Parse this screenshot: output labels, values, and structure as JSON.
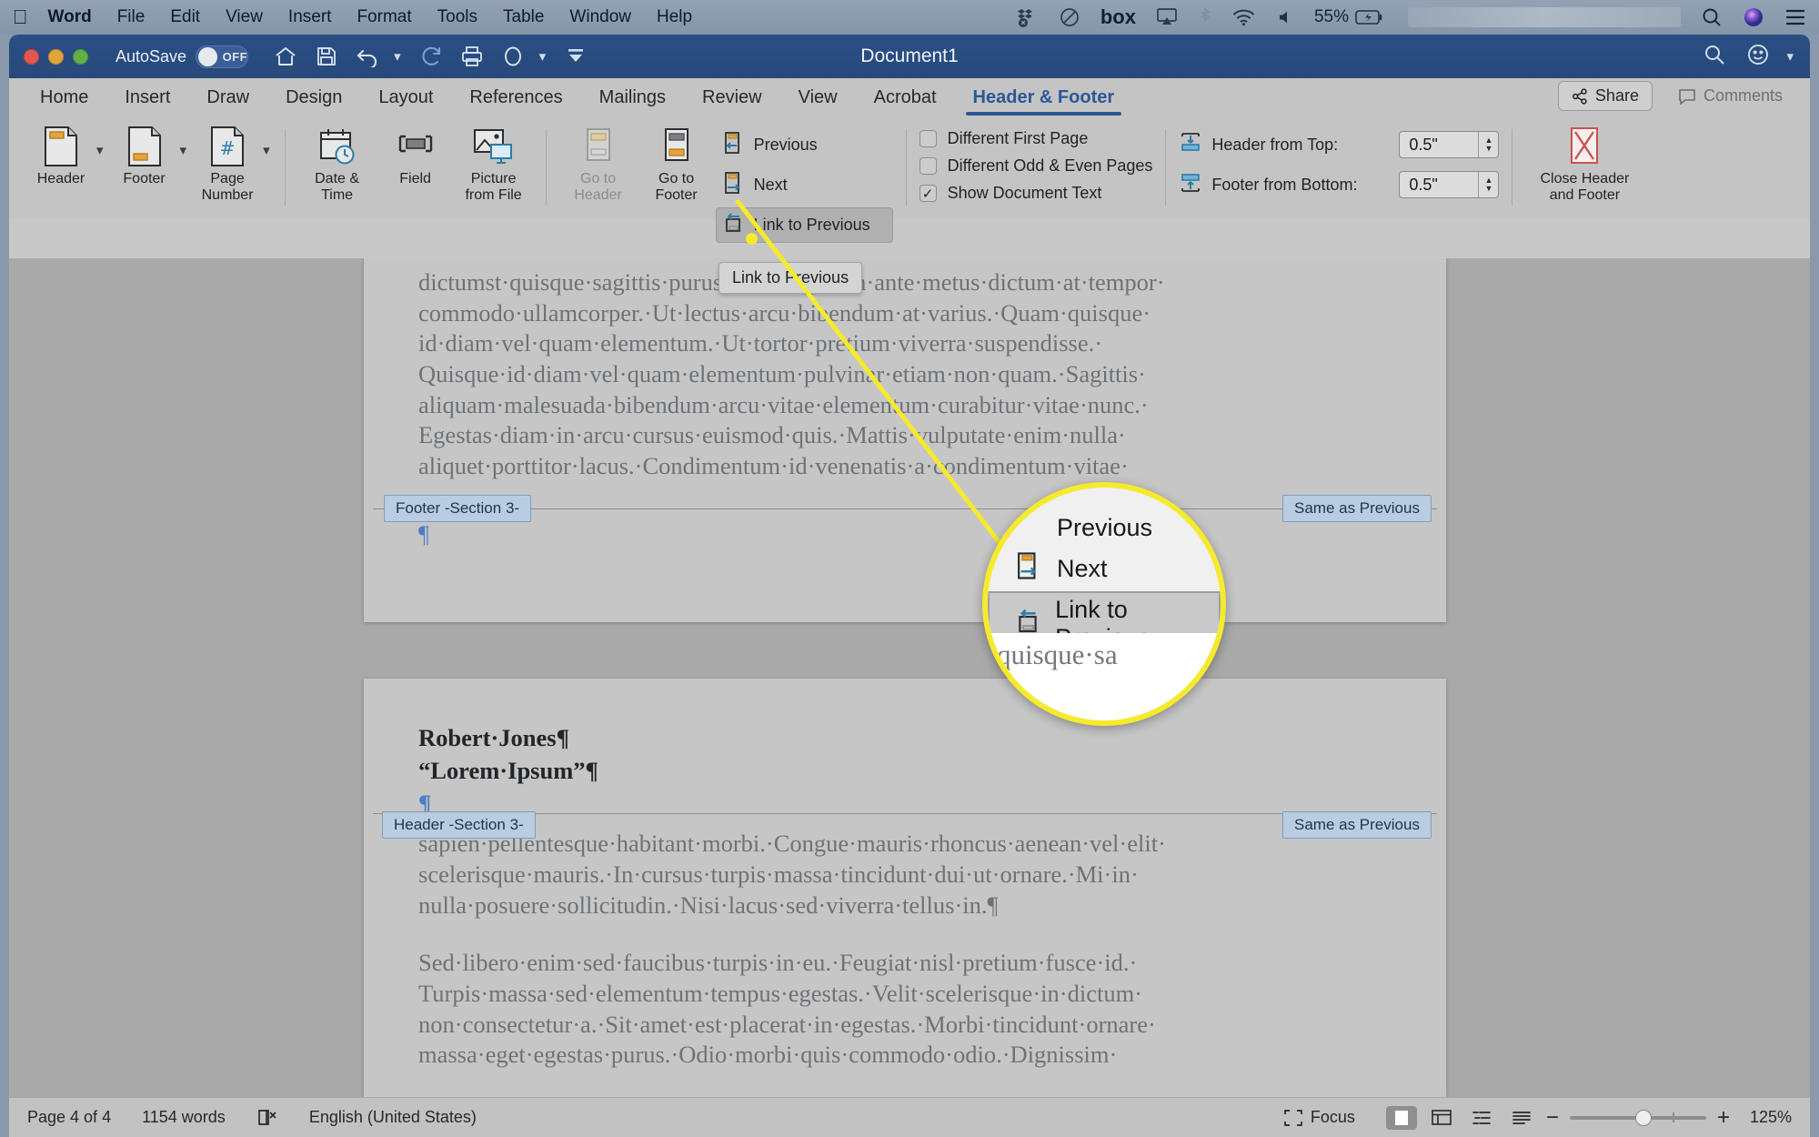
{
  "macbar": {
    "apple_icon": "apple-icon",
    "menus": [
      {
        "label": "Word",
        "bold": true
      },
      {
        "label": "File",
        "bold": false
      },
      {
        "label": "Edit",
        "bold": false
      },
      {
        "label": "View",
        "bold": false
      },
      {
        "label": "Insert",
        "bold": false
      },
      {
        "label": "Format",
        "bold": false
      },
      {
        "label": "Tools",
        "bold": false
      },
      {
        "label": "Table",
        "bold": false
      },
      {
        "label": "Window",
        "bold": false
      },
      {
        "label": "Help",
        "bold": false
      }
    ],
    "status_items": [
      {
        "name": "dropbox-paused-icon"
      },
      {
        "name": "adobe-creative-cloud-icon"
      },
      {
        "name": "box-icon",
        "label": "box"
      },
      {
        "name": "airplay-icon"
      },
      {
        "name": "bluetooth-icon"
      },
      {
        "name": "wifi-icon"
      },
      {
        "name": "volume-icon"
      }
    ],
    "battery_percent": "55%",
    "right_icons": [
      {
        "name": "spotlight-search-icon"
      },
      {
        "name": "siri-icon"
      },
      {
        "name": "control-center-icon"
      }
    ]
  },
  "titlebar": {
    "autosave_label": "AutoSave",
    "autosave_state": "OFF",
    "document_title": "Document1",
    "quick_access": [
      {
        "name": "home-icon"
      },
      {
        "name": "save-icon"
      },
      {
        "name": "undo-icon"
      },
      {
        "name": "undo-dropdown-caret"
      },
      {
        "name": "redo-icon"
      },
      {
        "name": "print-icon"
      },
      {
        "name": "format-painter-icon"
      },
      {
        "name": "format-painter-caret"
      },
      {
        "name": "customize-toolbar-icon"
      }
    ],
    "search_icon": "search-icon",
    "account_icon": "smiley-account-icon",
    "account_caret": "chevron-down-icon"
  },
  "ribbon": {
    "tabs": [
      {
        "label": "Home",
        "active": false
      },
      {
        "label": "Insert",
        "active": false
      },
      {
        "label": "Draw",
        "active": false
      },
      {
        "label": "Design",
        "active": false
      },
      {
        "label": "Layout",
        "active": false
      },
      {
        "label": "References",
        "active": false
      },
      {
        "label": "Mailings",
        "active": false
      },
      {
        "label": "Review",
        "active": false
      },
      {
        "label": "View",
        "active": false
      },
      {
        "label": "Acrobat",
        "active": false
      },
      {
        "label": "Header & Footer",
        "active": true
      }
    ],
    "share_label": "Share",
    "comments_label": "Comments",
    "buttons": [
      {
        "label": "Header",
        "icon": "header-icon",
        "caret": true,
        "dim": false
      },
      {
        "label": "Footer",
        "icon": "footer-icon",
        "caret": true,
        "dim": false
      },
      {
        "label": "Page\nNumber",
        "icon": "page-number-icon",
        "caret": true,
        "dim": false
      },
      {
        "label": "Date &\nTime",
        "icon": "date-time-icon",
        "caret": false,
        "dim": false
      },
      {
        "label": "Field",
        "icon": "field-icon",
        "caret": false,
        "dim": false
      },
      {
        "label": "Picture\nfrom File",
        "icon": "picture-from-file-icon",
        "caret": false,
        "dim": false
      },
      {
        "label": "Go to\nHeader",
        "icon": "go-to-header-icon",
        "caret": false,
        "dim": true
      },
      {
        "label": "Go to\nFooter",
        "icon": "go-to-footer-icon",
        "caret": false,
        "dim": false
      }
    ],
    "nav_items": [
      {
        "label": "Previous",
        "icon": "previous-section-icon",
        "selected": false
      },
      {
        "label": "Next",
        "icon": "next-section-icon",
        "selected": false
      },
      {
        "label": "Link to Previous",
        "icon": "link-to-previous-icon",
        "selected": true
      }
    ],
    "checkboxes": [
      {
        "label": "Different First Page",
        "checked": false
      },
      {
        "label": "Different Odd & Even Pages",
        "checked": false
      },
      {
        "label": "Show Document Text",
        "checked": true
      }
    ],
    "spinners": [
      {
        "label": "Header from Top:",
        "value": "0.5\"",
        "icon": "header-from-top-icon"
      },
      {
        "label": "Footer from Bottom:",
        "value": "0.5\"",
        "icon": "footer-from-bottom-icon"
      }
    ],
    "close_button": {
      "label": "Close Header\nand Footer",
      "icon": "close-header-footer-icon"
    }
  },
  "tooltip": {
    "text": "Link to Previous"
  },
  "magnifier": {
    "items": [
      {
        "label": "Previous",
        "icon": "previous-section-icon",
        "selected": false
      },
      {
        "label": "Next",
        "icon": "next-section-icon",
        "selected": false
      },
      {
        "label": "Link to Previous",
        "icon": "link-to-previous-icon",
        "selected": true
      }
    ],
    "tooltip_fragment": "L",
    "ghost_text": "quisque·sa",
    "border_color": "#f5ea2c"
  },
  "document": {
    "page_top": {
      "lines": [
        "dictumst·quisque·sagittis·purus·sit.·Feugiat·in·ante·metus·dictum·at·tempor·",
        "commodo·ullamcorper.·Ut·lectus·arcu·bibendum·at·varius.·Quam·quisque·",
        "id·diam·vel·quam·elementum.·Ut·tortor·pretium·viverra·suspendisse.·",
        "Quisque·id·diam·vel·quam·elementum·pulvinar·etiam·non·quam.·Sagittis·",
        "aliquam·malesuada·bibendum·arcu·vitae·elementum·curabitur·vitae·nunc.·",
        "Egestas·diam·in·arcu·cursus·euismod·quis.·Mattis·vulputate·enim·nulla·",
        "aliquet·porttitor·lacus.·Condimentum·id·venenatis·a·condimentum·vitae·"
      ]
    },
    "footer_tag_left": "Footer -Section 3-",
    "footer_tag_right": "Same as Previous",
    "footer_paragraph_mark": "¶",
    "header_block": {
      "author": "Robert·Jones¶",
      "title": "“Lorem·Ipsum”¶",
      "blank_mark": "¶"
    },
    "header_tag_left": "Header -Section 3-",
    "header_tag_right": "Same as Previous",
    "page_bottom": {
      "lines": [
        "sapien·pellentesque·habitant·morbi.·Congue·mauris·rhoncus·aenean·vel·elit·",
        "scelerisque·mauris.·In·cursus·turpis·massa·tincidunt·dui·ut·ornare.·Mi·in·",
        "nulla·posuere·sollicitudin.·Nisi·lacus·sed·viverra·tellus·in.¶"
      ],
      "lines2": [
        "Sed·libero·enim·sed·faucibus·turpis·in·eu.·Feugiat·nisl·pretium·fusce·id.·",
        "Turpis·massa·sed·elementum·tempus·egestas.·Velit·scelerisque·in·dictum·",
        "non·consectetur·a.·Sit·amet·est·placerat·in·egestas.·Morbi·tincidunt·ornare·",
        "massa·eget·egestas·purus.·Odio·morbi·quis·commodo·odio.·Dignissim·"
      ]
    }
  },
  "status": {
    "page_info": "Page 4 of 4",
    "word_count": "1154 words",
    "proofing_icon": "proofing-errors-icon",
    "language": "English (United States)",
    "focus_label": "Focus",
    "focus_icon": "focus-icon",
    "view_buttons": [
      {
        "name": "print-layout-view",
        "active": true
      },
      {
        "name": "web-layout-view",
        "active": false
      },
      {
        "name": "outline-view",
        "active": false
      },
      {
        "name": "draft-view",
        "active": false
      }
    ],
    "zoom_out_icon": "zoom-out-icon",
    "zoom_in_icon": "zoom-in-icon",
    "zoom_level": "125%"
  }
}
